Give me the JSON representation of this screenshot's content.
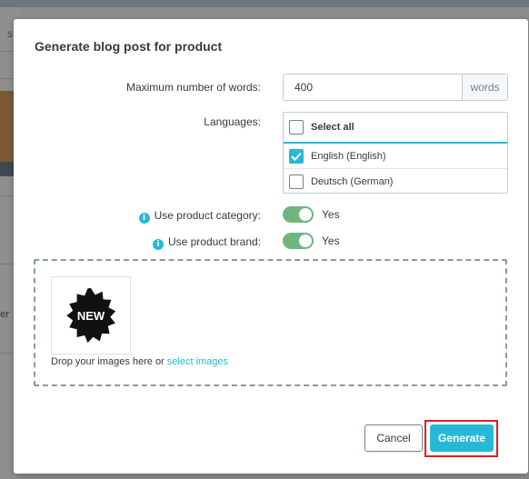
{
  "background": {
    "left_tab_fragment": "s",
    "left_text_fragment": "ver"
  },
  "modal": {
    "title": "Generate blog post for product"
  },
  "max_words": {
    "label": "Maximum number of words:",
    "value": "400",
    "unit": "words"
  },
  "languages": {
    "label": "Languages:",
    "select_all_label": "Select all",
    "select_all_checked": false,
    "options": [
      {
        "label": "English (English)",
        "checked": true
      },
      {
        "label": "Deutsch (German)",
        "checked": false
      }
    ]
  },
  "use_category": {
    "label": "Use product category:",
    "state_label": "Yes",
    "enabled": true
  },
  "use_brand": {
    "label": "Use product brand:",
    "state_label": "Yes",
    "enabled": true
  },
  "dropzone": {
    "text": "Drop your images here or ",
    "link": "select images",
    "thumbnail_badge": "NEW"
  },
  "buttons": {
    "cancel": "Cancel",
    "generate": "Generate"
  },
  "colors": {
    "accent": "#25b9d7",
    "switch_on": "#70b580",
    "highlight_outline": "#e31b23"
  }
}
